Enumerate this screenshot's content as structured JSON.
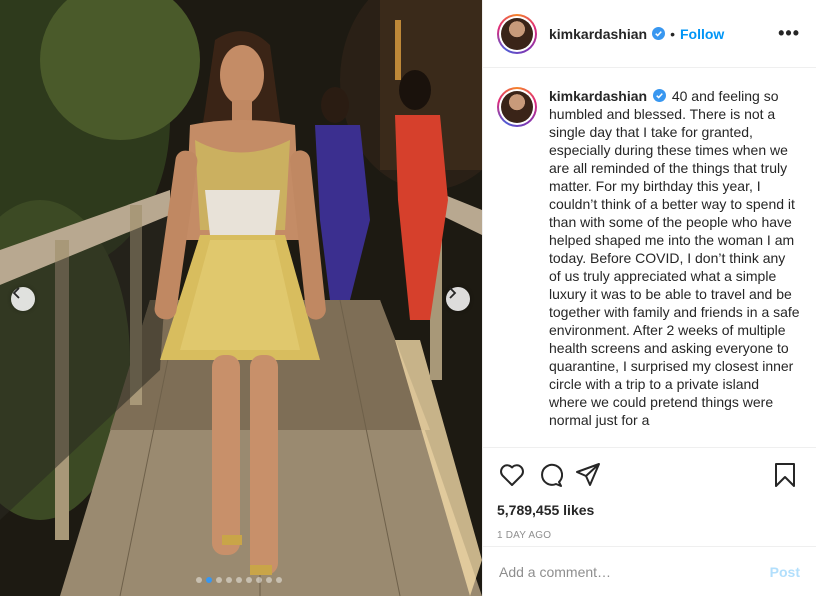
{
  "post": {
    "username": "kimkardashian",
    "follow_label": "Follow",
    "separator": "•",
    "more_label": "•••",
    "caption": "40 and feeling so humbled and blessed. There is not a single day that I take for granted, especially during these times when we are all reminded of the things that truly matter. For my birthday this year, I couldn’t think of a better way to spend it than with some of the people who have helped shaped me into the woman I am today. Before COVID, I don’t think any of us truly appreciated what a simple luxury it was to be able to travel and be together with family and friends in a safe environment. After 2 weeks of multiple health screens and asking everyone to quarantine, I surprised my closest inner circle with a trip to a private island where we could pretend things were normal just for a",
    "likes": "5,789,455 likes",
    "date": "1 DAY AGO",
    "comment_placeholder": "Add a comment…",
    "post_label": "Post",
    "carousel": {
      "count": 9,
      "active_index": 1
    }
  },
  "icons": {
    "verified": "verified-badge-icon",
    "like": "heart-icon",
    "comment": "comment-icon",
    "share": "share-icon",
    "save": "bookmark-icon",
    "prev": "chevron-left-icon",
    "next": "chevron-right-icon"
  },
  "colors": {
    "accent": "#0095f6",
    "verified": "#3897f0",
    "muted": "#8e8e8e",
    "post_disabled": "#b2dffc"
  }
}
